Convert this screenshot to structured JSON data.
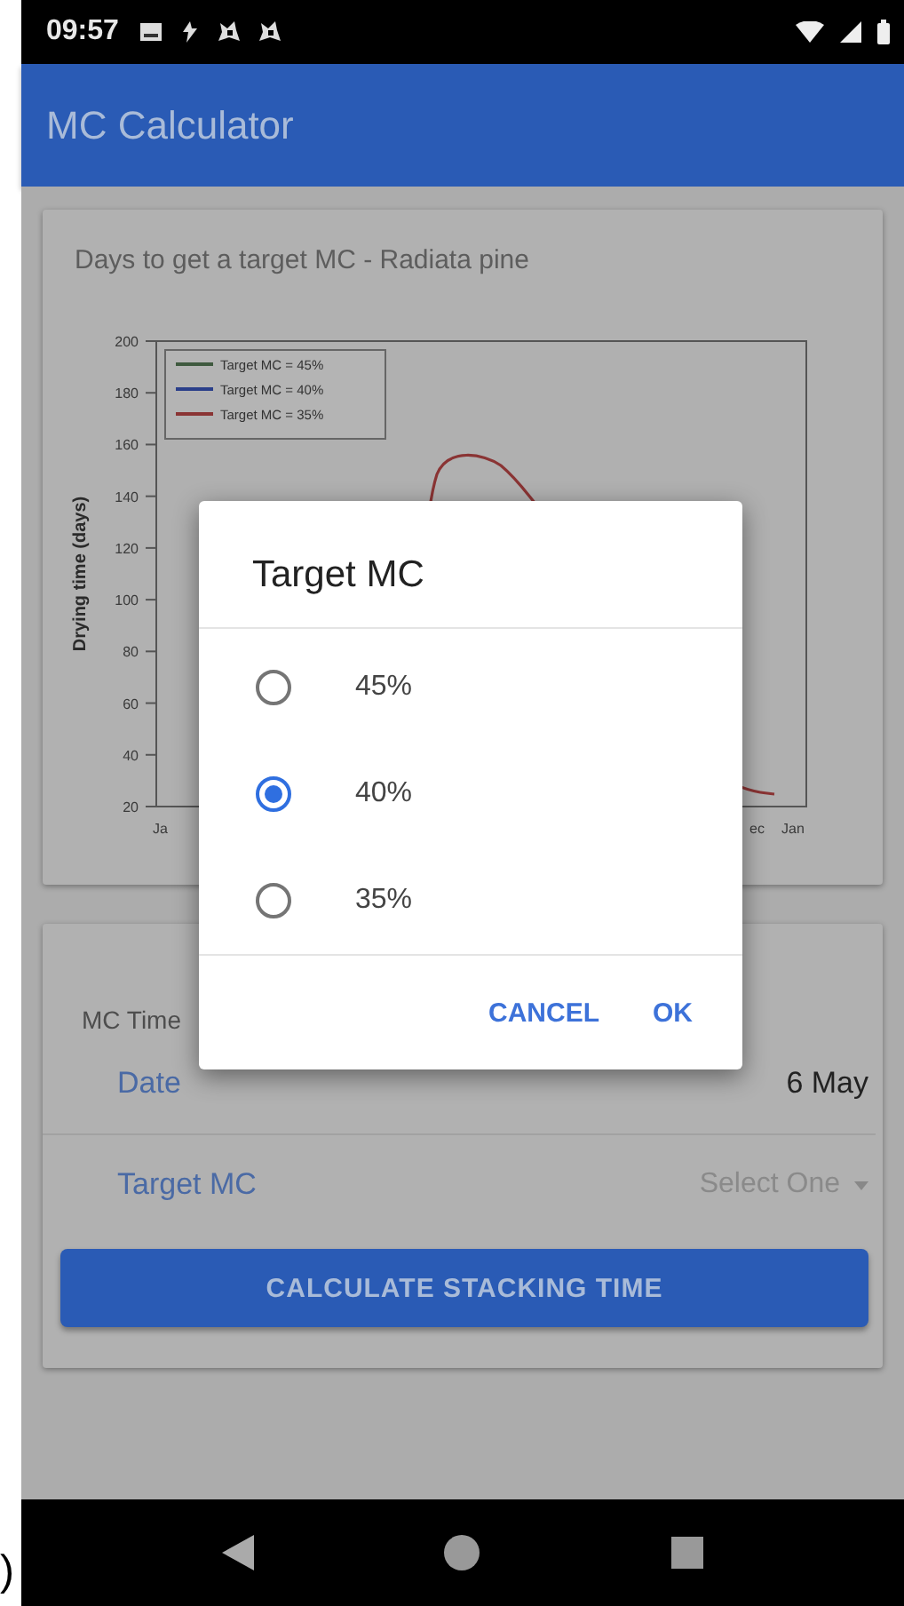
{
  "status_bar": {
    "time": "09:57"
  },
  "app_bar": {
    "title": "MC Calculator"
  },
  "chart_card": {
    "title": "Days to get a target MC - Radiata pine",
    "y_axis_label": "Drying time (days)",
    "y_ticks": [
      "200",
      "180",
      "160",
      "140",
      "120",
      "100",
      "80",
      "60",
      "40",
      "20"
    ],
    "x_ticks": [
      "Ja",
      "ec",
      "Jan"
    ],
    "legend": [
      {
        "label": "Target MC = 45%",
        "color": "#3f5a3f"
      },
      {
        "label": "Target MC = 40%",
        "color": "#2a3f8a"
      },
      {
        "label": "Target MC = 35%",
        "color": "#8a3434"
      }
    ]
  },
  "form_card": {
    "title": "MC Time",
    "rows": [
      {
        "kind": "text",
        "label": "Date",
        "value": "6 May"
      },
      {
        "kind": "dropdown",
        "label": "Target MC",
        "value": "Select One"
      }
    ],
    "button": "CALCULATE STACKING TIME"
  },
  "dialog": {
    "title": "Target MC",
    "options": [
      {
        "label": "45%",
        "selected": false
      },
      {
        "label": "40%",
        "selected": true
      },
      {
        "label": "35%",
        "selected": false
      }
    ],
    "buttons": [
      "CANCEL",
      "OK"
    ]
  },
  "edge_text": ")"
}
